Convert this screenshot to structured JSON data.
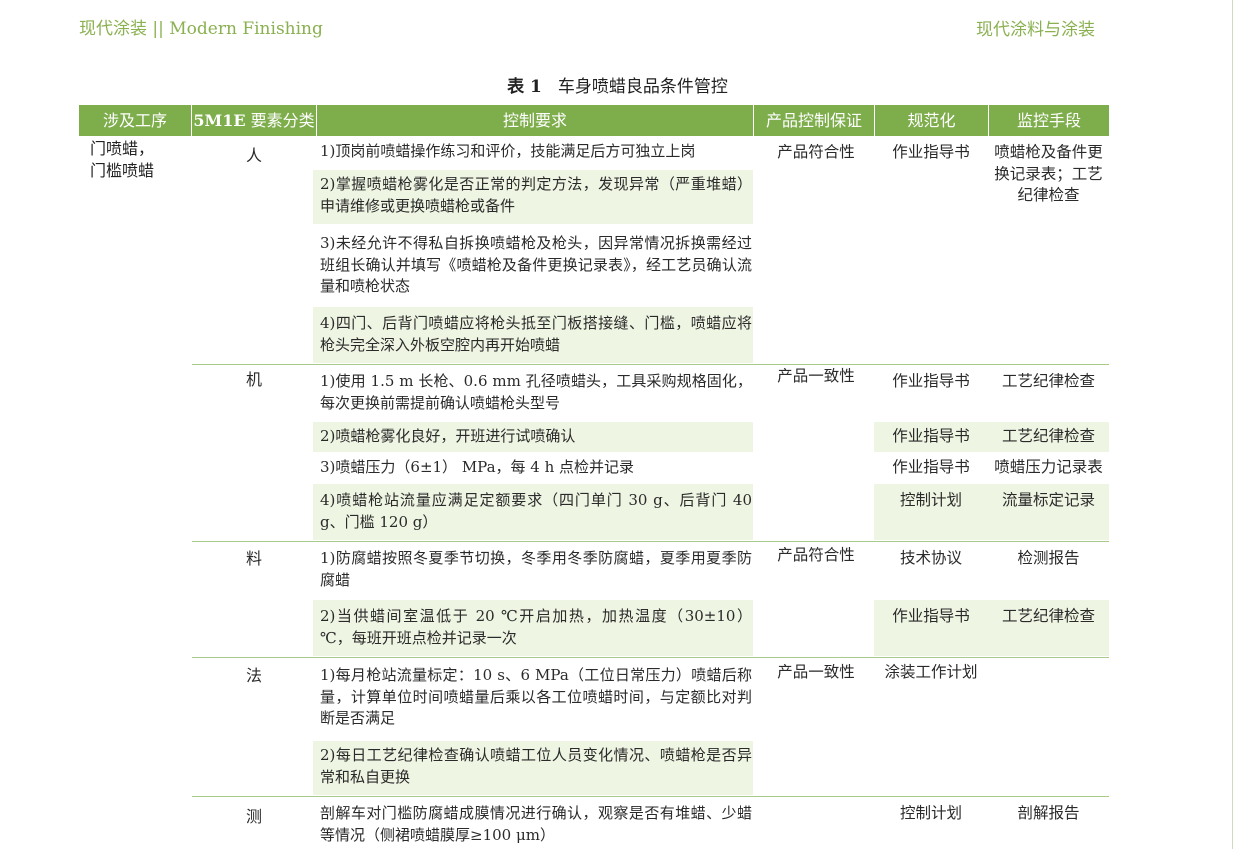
{
  "header": {
    "left": "现代涂装 || Modern Finishing",
    "right": "现代涂料与涂装"
  },
  "table": {
    "caption_num": "表 1",
    "caption_text": "车身喷蜡良品条件管控",
    "columns": [
      "涉及工序",
      "5M1E",
      "要素分类",
      "控制要求",
      "产品控制保证",
      "规范化",
      "监控手段"
    ],
    "process": [
      "门喷蜡，",
      "门槛喷蜡"
    ],
    "categories": [
      "人",
      "机",
      "料",
      "法",
      "测"
    ],
    "rows": [
      {
        "req": "1)顶岗前喷蜡操作练习和评价，技能满足后方可独立上岗",
        "assurance": "产品符合性",
        "spec": "作业指导书",
        "monitor": "喷蜡枪及备件更换记录表；工艺纪律检查"
      },
      {
        "req": "2)掌握喷蜡枪雾化是否正常的判定方法，发现异常（严重堆蜡）申请维修或更换喷蜡枪或备件"
      },
      {
        "req": "3)未经允许不得私自拆换喷蜡枪及枪头，因异常情况拆换需经过班组长确认并填写《喷蜡枪及备件更换记录表》，经工艺员确认流量和喷枪状态"
      },
      {
        "req": "4)四门、后背门喷蜡应将枪头抵至门板搭接缝、门槛，喷蜡应将枪头完全深入外板空腔内再开始喷蜡"
      },
      {
        "req": "1)使用 1.5 m 长枪、0.6 mm 孔径喷蜡头，工具采购规格固化，每次更换前需提前确认喷蜡枪头型号",
        "assurance": "产品一致性",
        "spec": "作业指导书",
        "monitor": "工艺纪律检查"
      },
      {
        "req": "2)喷蜡枪雾化良好，开班进行试喷确认",
        "spec": "作业指导书",
        "monitor": "工艺纪律检查"
      },
      {
        "req": "3)喷蜡压力（6±1） MPa，每 4 h 点检并记录",
        "spec": "作业指导书",
        "monitor": "喷蜡压力记录表"
      },
      {
        "req": "4)喷蜡枪站流量应满足定额要求（四门单门 30 g、后背门 40 g、门槛 120 g）",
        "spec": "控制计划",
        "monitor": "流量标定记录"
      },
      {
        "req": "1)防腐蜡按照冬夏季节切换，冬季用冬季防腐蜡，夏季用夏季防腐蜡",
        "assurance": "产品符合性",
        "spec": "技术协议",
        "monitor": "检测报告"
      },
      {
        "req": "2)当供蜡间室温低于 20 ℃开启加热，加热温度（30±10） ℃，每班开班点检并记录一次",
        "spec": "作业指导书",
        "monitor": "工艺纪律检查"
      },
      {
        "req": "1)每月枪站流量标定：10 s、6 MPa（工位日常压力）喷蜡后称量，计算单位时间喷蜡量后乘以各工位喷蜡时间，与定额比对判断是否满足",
        "assurance": "产品一致性",
        "spec": "涂装工作计划"
      },
      {
        "req": "2)每日工艺纪律检查确认喷蜡工位人员变化情况、喷蜡枪是否异常和私自更换"
      },
      {
        "req": "剖解车对门槛防腐蜡成膜情况进行确认，观察是否有堆蜡、少蜡等情况（侧裙喷蜡膜厚≥100 μm）",
        "spec": "控制计划",
        "monitor": "剖解报告"
      }
    ]
  },
  "colors": {
    "header_green": "#7ead4c",
    "band_green": "#eef5e3",
    "title_green": "#8ab050"
  }
}
